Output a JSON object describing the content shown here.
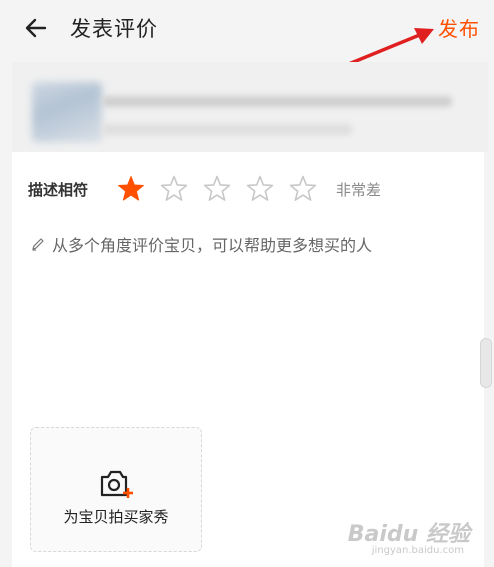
{
  "header": {
    "title": "发表评价",
    "publish_label": "发布"
  },
  "rating": {
    "label": "描述相符",
    "value": 1,
    "max": 5,
    "text": "非常差",
    "active_color": "#ff5000",
    "inactive_color": "#c8c8c8"
  },
  "review": {
    "placeholder": "从多个角度评价宝贝，可以帮助更多想买的人"
  },
  "photo": {
    "label": "为宝贝拍买家秀"
  },
  "watermark": {
    "text": "Baidu 经验",
    "sub": "jingyan.baidu.com"
  },
  "colors": {
    "accent": "#ff5000",
    "annotation_arrow": "#e02020"
  }
}
